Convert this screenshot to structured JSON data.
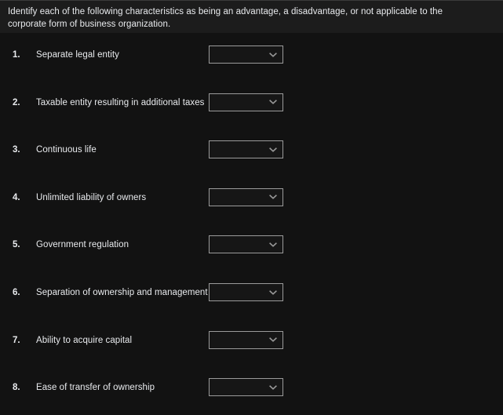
{
  "instruction": {
    "text": "Identify each of the following characteristics as being an advantage, a disadvantage, or not applicable to the corporate form of business organization."
  },
  "colors": {
    "page_background": "#121212",
    "instruction_background": "#1c1c1c",
    "text": "#e9ebee",
    "select_border": "#9b9b9b",
    "select_background": "#161616",
    "chevron": "#9a9a9a"
  },
  "items": [
    {
      "number": "1.",
      "label": "Separate legal entity",
      "select_value": "",
      "select_icon": "chevron-down-icon"
    },
    {
      "number": "2.",
      "label": "Taxable entity resulting in additional taxes",
      "select_value": "",
      "select_icon": "chevron-down-icon"
    },
    {
      "number": "3.",
      "label": "Continuous life",
      "select_value": "",
      "select_icon": "chevron-down-icon"
    },
    {
      "number": "4.",
      "label": "Unlimited liability of owners",
      "select_value": "",
      "select_icon": "chevron-down-icon"
    },
    {
      "number": "5.",
      "label": "Government regulation",
      "select_value": "",
      "select_icon": "chevron-down-icon"
    },
    {
      "number": "6.",
      "label": "Separation of ownership and management",
      "select_value": "",
      "select_icon": "chevron-down-icon"
    },
    {
      "number": "7.",
      "label": "Ability to acquire capital",
      "select_value": "",
      "select_icon": "chevron-down-icon"
    },
    {
      "number": "8.",
      "label": "Ease of transfer of ownership",
      "select_value": "",
      "select_icon": "chevron-down-icon"
    }
  ]
}
